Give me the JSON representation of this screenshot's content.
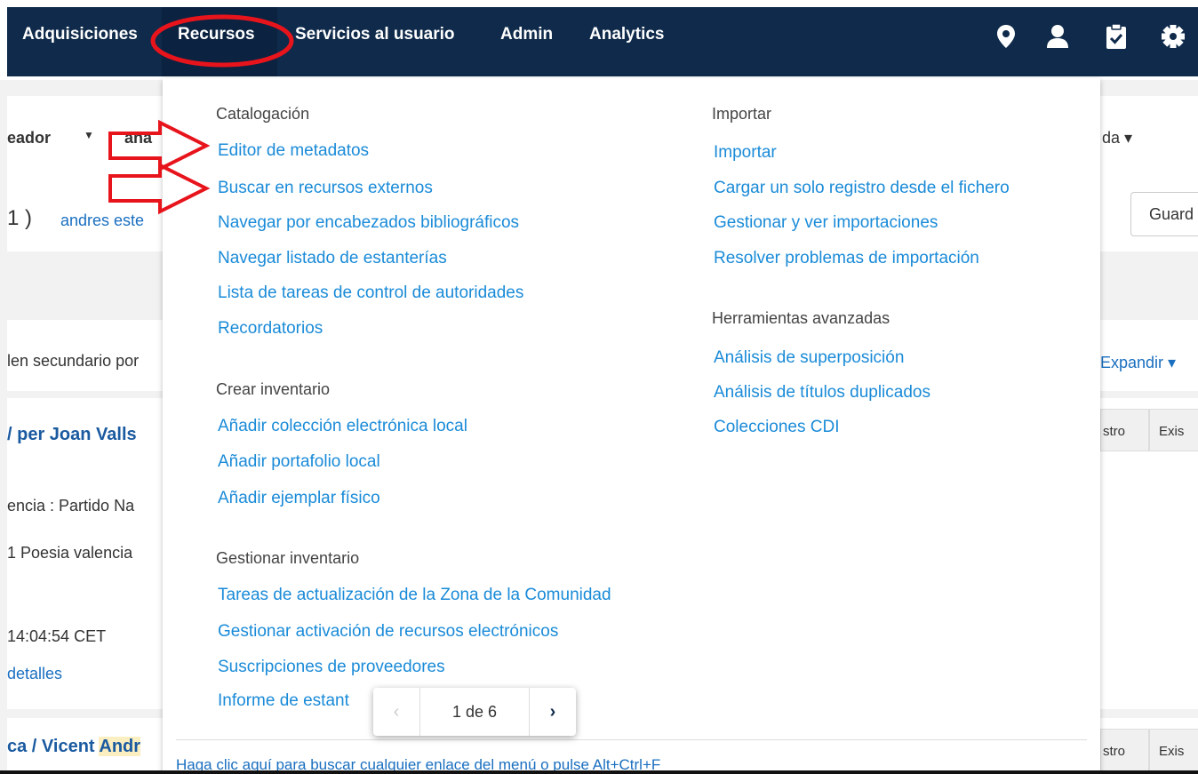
{
  "nav": {
    "items": [
      "Adquisiciones",
      "Recursos",
      "Servicios al usuario",
      "Admin",
      "Analytics"
    ],
    "icons": [
      "location-pin-icon",
      "user-icon",
      "clipboard-check-icon",
      "gear-icon"
    ]
  },
  "background": {
    "toolbar_field": "eador",
    "toolbar_field2": "ana",
    "toolbar_right": "da ▾",
    "count_paren": "1 )",
    "user_link": "andres este",
    "save_button": "Guard",
    "sort_text": "len secundario por",
    "expand": "Expandir ▾",
    "result1_title": "/ per Joan Valls",
    "result1_line1": "encia : Partido Na",
    "result1_line2": "1 Poesia valencia",
    "result1_time": "14:04:54 CET",
    "result1_details": "detalles",
    "result2_title_a": "ca / Vicent ",
    "result2_title_b": "Andr",
    "tab_registro": "stro",
    "tab_existencias": "Exis"
  },
  "menu": {
    "catalogacion": {
      "heading": "Catalogación",
      "links": [
        "Editor de metadatos",
        "Buscar en recursos externos",
        "Navegar por encabezados bibliográficos",
        "Navegar listado de estanterías",
        "Lista de tareas de control de autoridades",
        "Recordatorios"
      ]
    },
    "crear": {
      "heading": "Crear inventario",
      "links": [
        "Añadir colección electrónica local",
        "Añadir portafolio local",
        "Añadir ejemplar físico"
      ]
    },
    "gestionar": {
      "heading": "Gestionar inventario",
      "links": [
        "Tareas de actualización de la Zona de la Comunidad",
        "Gestionar activación de recursos electrónicos",
        "Suscripciones de proveedores",
        "Informe de estant"
      ]
    },
    "importar": {
      "heading": "Importar",
      "links": [
        "Importar",
        "Cargar un solo registro desde el fichero",
        "Gestionar y ver importaciones",
        "Resolver problemas de importación"
      ]
    },
    "avanzadas": {
      "heading": "Herramientas avanzadas",
      "links": [
        "Análisis de superposición",
        "Análisis de títulos duplicados",
        "Colecciones CDI"
      ]
    },
    "hint": "Haga clic aquí para buscar cualquier enlace del menú o pulse Alt+Ctrl+F"
  },
  "pager": {
    "label": "1 de 6",
    "prev": "‹",
    "next": "›"
  },
  "colors": {
    "navbar": "#0f2a4a",
    "link": "#1a8bd8",
    "annotation": "#e8141c"
  }
}
